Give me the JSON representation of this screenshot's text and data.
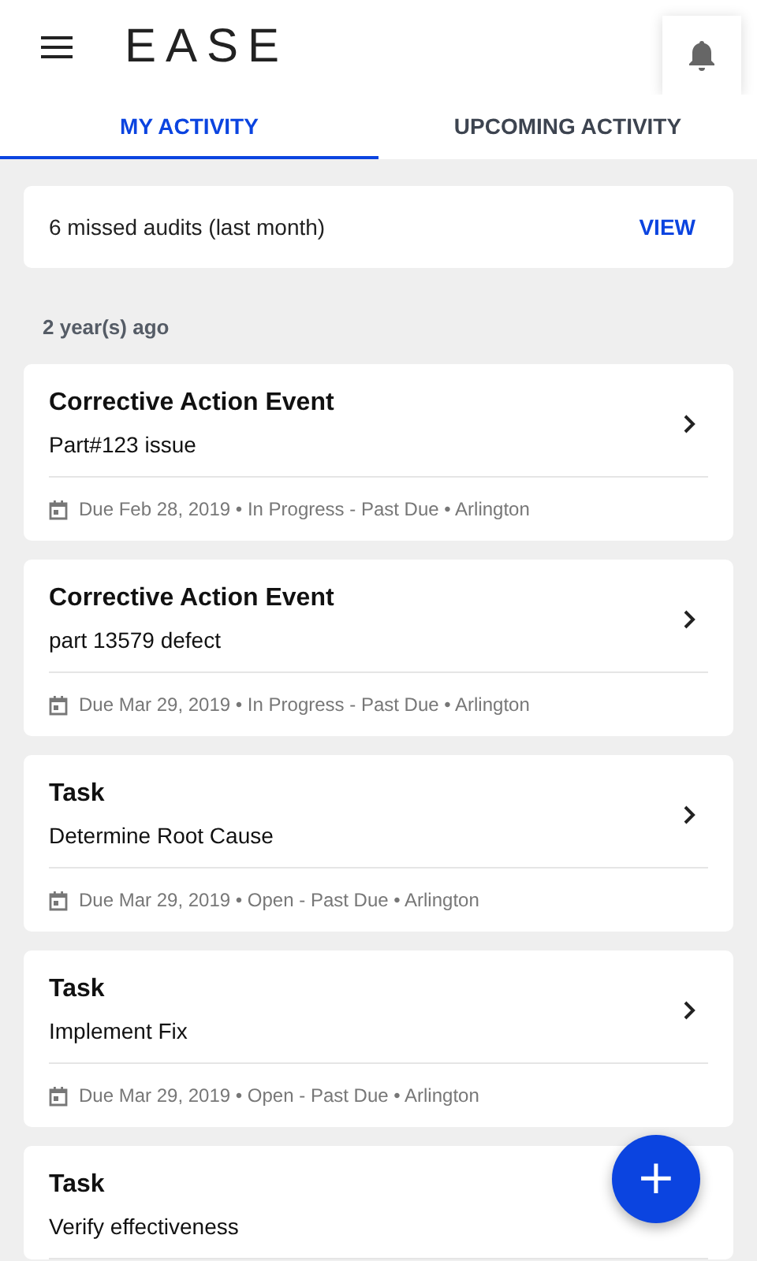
{
  "header": {
    "logo": "EASE"
  },
  "tabs": [
    {
      "label": "MY ACTIVITY",
      "selected": true
    },
    {
      "label": "UPCOMING ACTIVITY",
      "selected": false
    }
  ],
  "banner": {
    "text": "6 missed audits (last month)",
    "action": "VIEW"
  },
  "section": "2 year(s) ago",
  "items": [
    {
      "title": "Corrective Action Event",
      "subtitle": "Part#123 issue",
      "meta": "Due Feb 28, 2019 • In Progress - Past Due • Arlington",
      "chevron": true
    },
    {
      "title": "Corrective Action Event",
      "subtitle": "part 13579 defect",
      "meta": "Due Mar 29, 2019 • In Progress - Past Due • Arlington",
      "chevron": true
    },
    {
      "title": "Task",
      "subtitle": "Determine Root Cause",
      "meta": "Due Mar 29, 2019 • Open - Past Due • Arlington",
      "chevron": true
    },
    {
      "title": "Task",
      "subtitle": "Implement Fix",
      "meta": "Due Mar 29, 2019 • Open - Past Due • Arlington",
      "chevron": true
    },
    {
      "title": "Task",
      "subtitle": "Verify effectiveness",
      "chevron": false
    }
  ],
  "fab": {
    "label": "+"
  }
}
